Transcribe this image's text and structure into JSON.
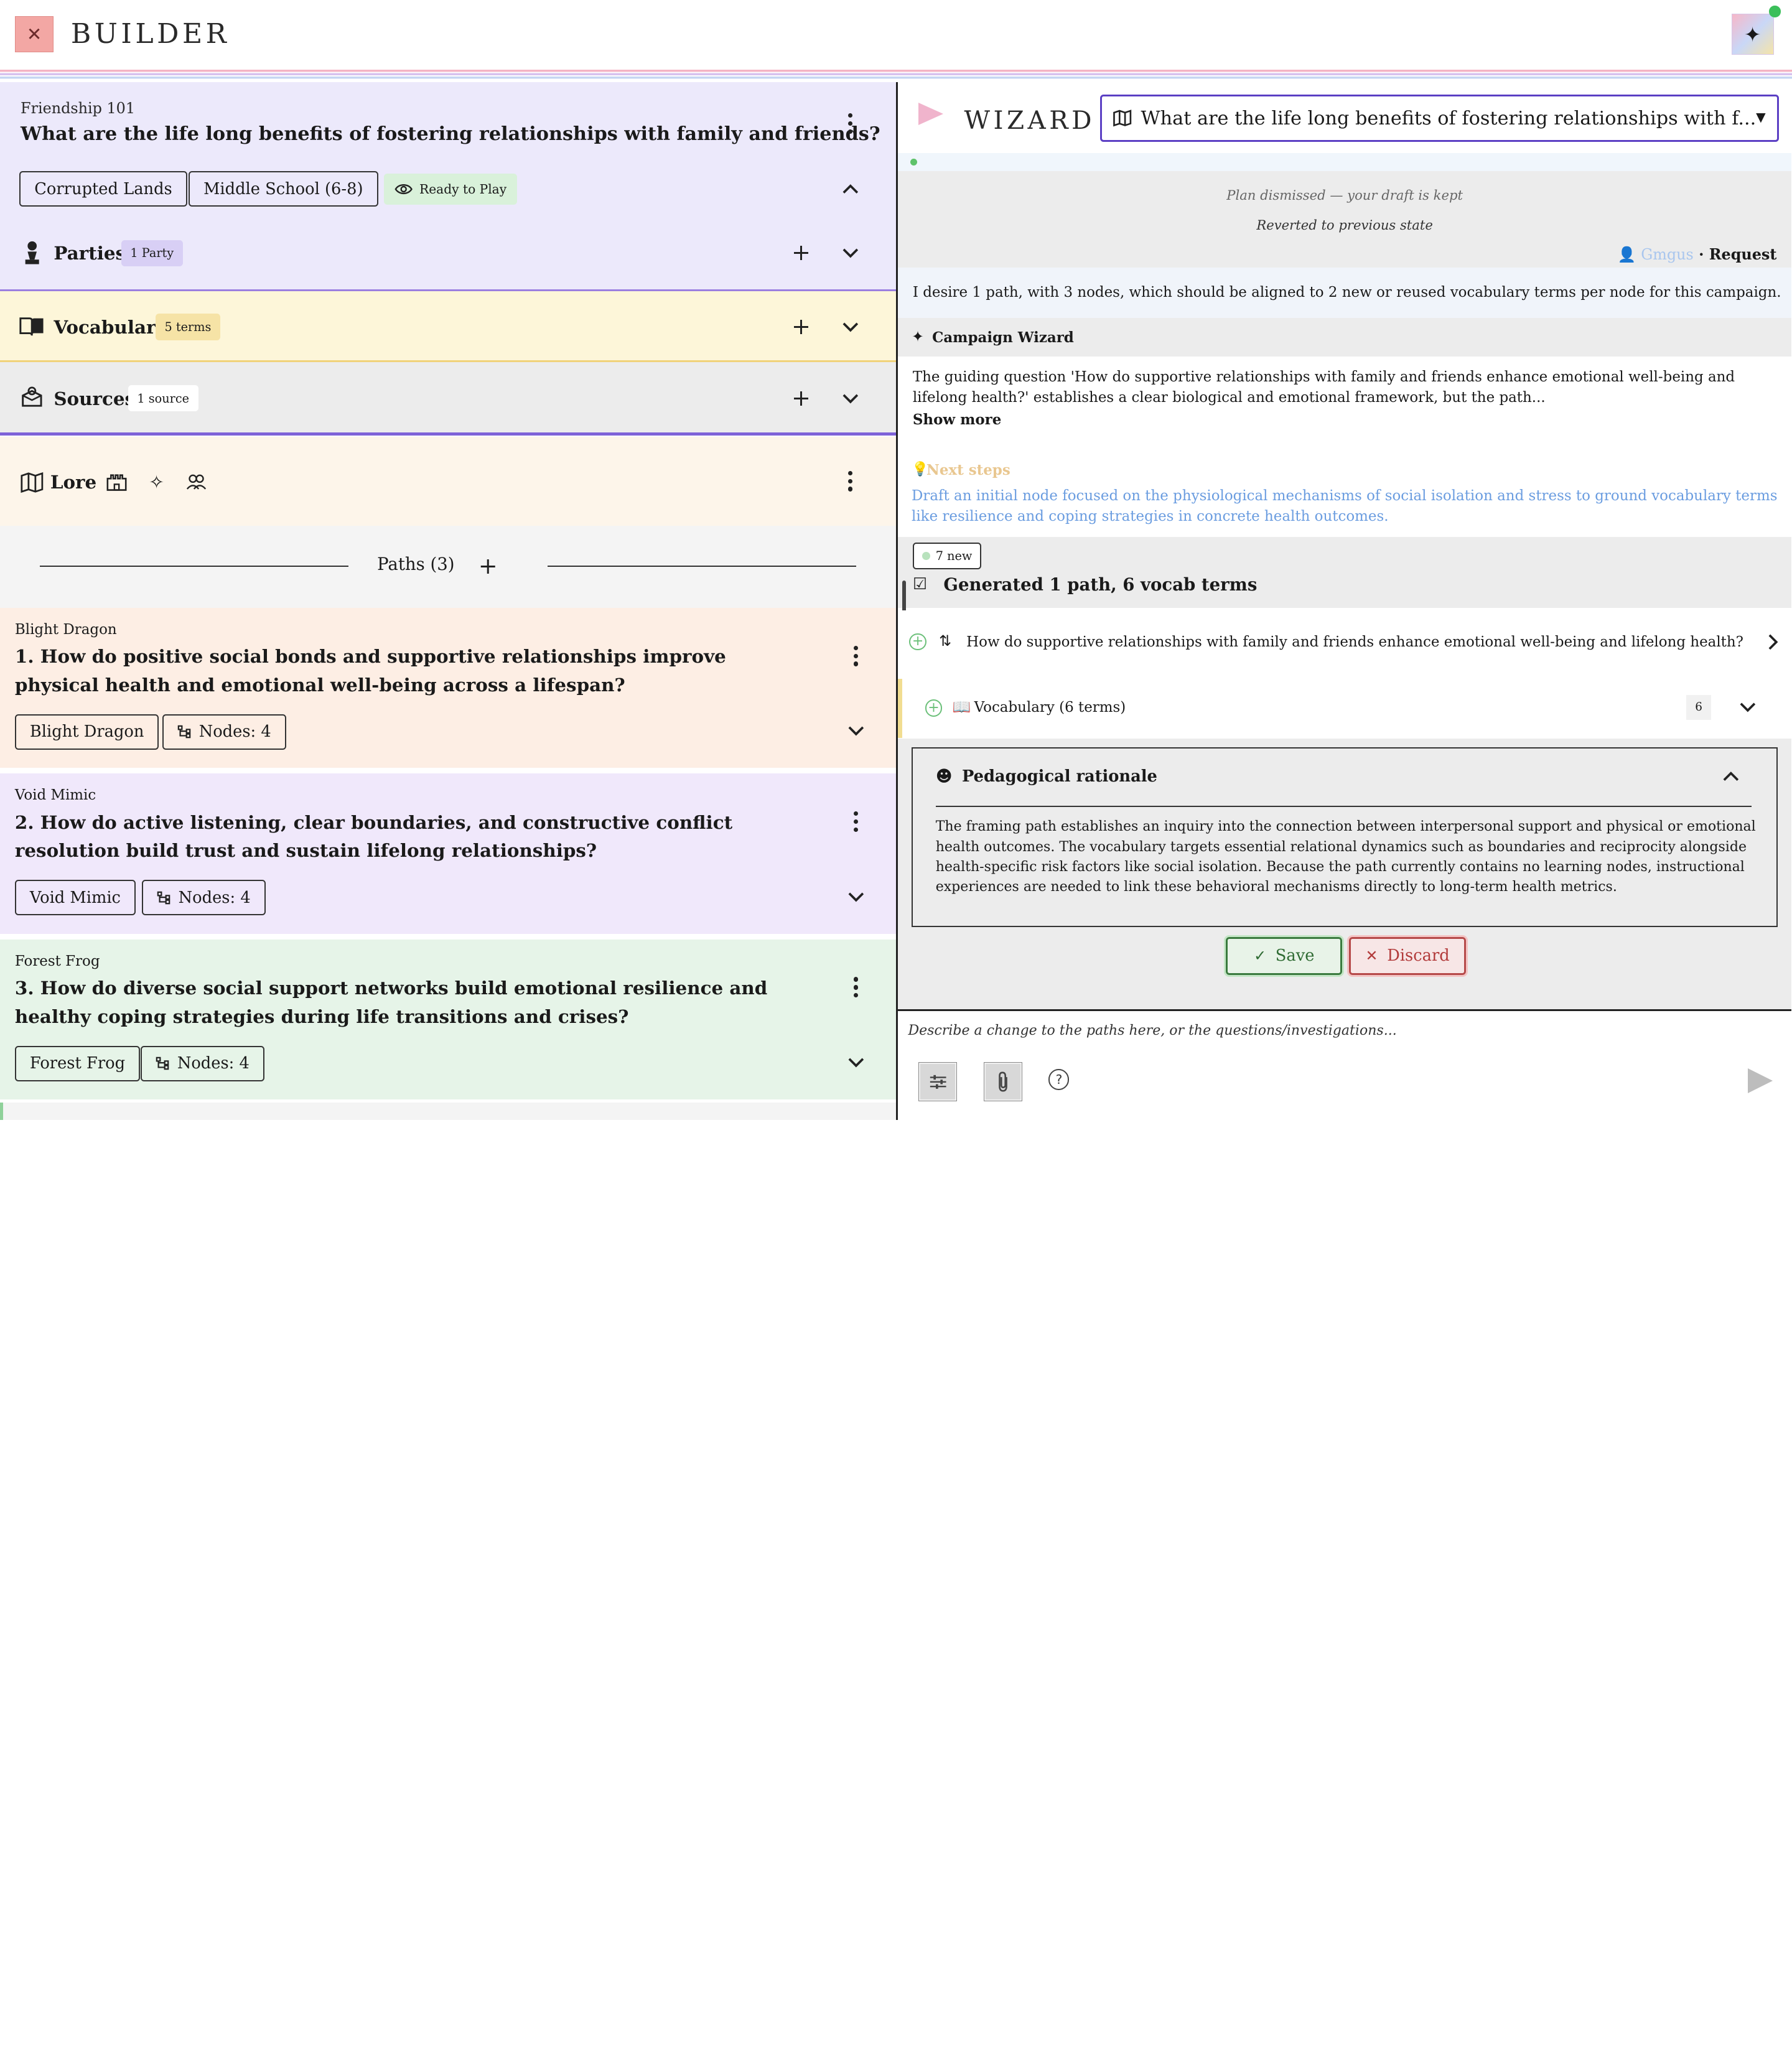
{
  "app": {
    "brand": "BUILDER",
    "close_glyph": "✕",
    "magic_glyph": "✦"
  },
  "campaign": {
    "subtitle": "Friendship 101",
    "title": "What are the life long benefits of fostering relationships with family and friends?",
    "tags": [
      "Corrupted Lands",
      "Middle School (6-8)"
    ],
    "status": "Ready to Play"
  },
  "sections": {
    "parties": {
      "label": "Parties",
      "badge": "1 Party",
      "color": "#ece9fb",
      "badge_color": "#d8cff5"
    },
    "vocabulary": {
      "label": "Vocabulary",
      "badge": "5 terms",
      "color": "#fdf6d9",
      "badge_color": "#f6e3a6"
    },
    "sources": {
      "label": "Sources",
      "badge": "1 source",
      "color": "#ececec",
      "badge_color": "#ffffff"
    },
    "lore": {
      "label": "Lore",
      "color": "#fdf5ea"
    }
  },
  "paths": {
    "label": "Paths (3)",
    "items": [
      {
        "owner": "Blight Dragon",
        "question": "1. How do positive social bonds and supportive relationships improve physical health and emotional well-being across a lifespan?",
        "tag": "Blight Dragon",
        "nodes": "Nodes: 4",
        "color": "#fdeee4"
      },
      {
        "owner": "Void Mimic",
        "question": "2. How do active listening, clear boundaries, and constructive conflict resolution build trust and sustain lifelong relationships?",
        "tag": "Void Mimic",
        "nodes": "Nodes: 4",
        "color": "#f0e8fb"
      },
      {
        "owner": "Forest Frog",
        "question": "3. How do diverse social support networks build emotional resilience and healthy coping strategies during life transitions and crises?",
        "tag": "Forest Frog",
        "nodes": "Nodes: 4",
        "color": "#e6f4e8"
      }
    ]
  },
  "wizard": {
    "title": "WIZARD",
    "selected_question": "What are the life long benefits of fostering relationships with f...",
    "system_msg_1": "Plan dismissed — your draft is kept",
    "system_msg_2": "Reverted to previous state",
    "request_user": "Gmgus",
    "request_label": " · Request",
    "user_message": "I desire 1 path, with 3 nodes, which should be aligned to 2 new or reused vocabulary terms per node for this campaign.",
    "assistant_name": "Campaign Wizard",
    "assistant_text": "The guiding question 'How do supportive relationships with family and friends enhance emotional well-being and lifelong health?' establishes a clear biological and emotional framework, but the path...",
    "show_more": "Show more",
    "next_steps_label": "Next steps",
    "next_steps_text": "Draft an initial node focused on the physiological mechanisms of social isolation and stress to ground vocabulary terms like resilience and coping strategies in concrete health outcomes.",
    "new_badge": "7 new",
    "generated_title": "Generated 1 path, 6 vocab terms",
    "generated_path": "How do supportive relationships with family and friends enhance emotional well-being and lifelong health?",
    "generated_vocab": "Vocabulary (6 terms)",
    "generated_vocab_count": "6",
    "rationale_title": "Pedagogical rationale",
    "rationale_text": "The framing path establishes an inquiry into the connection between interpersonal support and physical or emotional health outcomes. The vocabulary targets essential relational dynamics such as boundaries and reciprocity alongside health-specific risk factors like social isolation. Because the path currently contains no learning nodes, instructional experiences are needed to link these behavioral mechanisms directly to long-term health metrics.",
    "save_label": "Save",
    "discard_label": "Discard",
    "composer_placeholder": "Describe a change to the paths here, or the questions/investigations..."
  },
  "icons": {
    "map": "🗺",
    "book": "📖",
    "check": "✓",
    "cross": "✕"
  }
}
